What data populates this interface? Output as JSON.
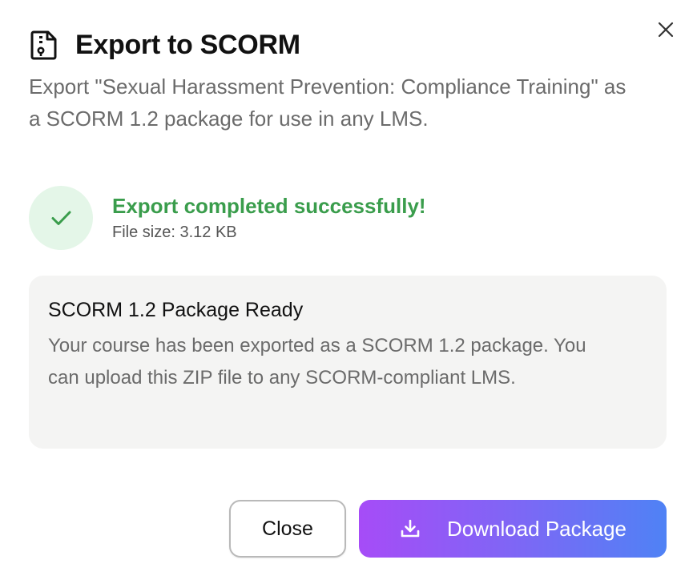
{
  "dialog": {
    "title": "Export to SCORM",
    "subtitle": "Export \"Sexual Harassment Prevention: Compliance Training\" as a SCORM 1.2 package for use in any LMS.",
    "icons": {
      "title": "file-zip-icon",
      "close": "close-icon",
      "status": "check-icon",
      "download": "download-icon"
    }
  },
  "status": {
    "headline": "Export completed successfully!",
    "file_size": "File size: 3.12 KB",
    "color": "#3a9d4c"
  },
  "info_card": {
    "title": "SCORM 1.2 Package Ready",
    "body": "Your course has been exported as a SCORM 1.2 package. You can upload this ZIP file to any SCORM-compliant LMS."
  },
  "actions": {
    "close_label": "Close",
    "download_label": "Download Package"
  },
  "colors": {
    "gradient_start": "#a64cf7",
    "gradient_end": "#4f82f5",
    "success_bg": "#e4f6e8"
  }
}
